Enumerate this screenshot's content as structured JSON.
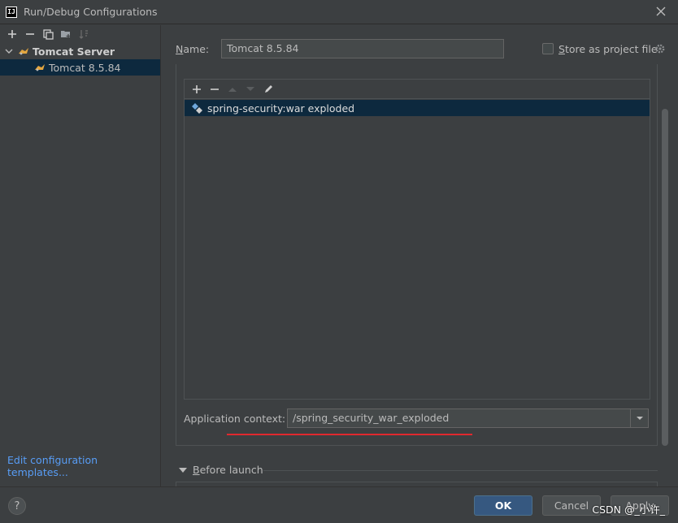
{
  "window": {
    "title": "Run/Debug Configurations",
    "logo_text": "IJ"
  },
  "left": {
    "tree": {
      "group_label": "Tomcat Server",
      "child_label": "Tomcat 8.5.84"
    },
    "edit_templates_link": "Edit configuration templates..."
  },
  "form": {
    "name_label_underlined": "N",
    "name_label_rest": "ame:",
    "name_value": "Tomcat 8.5.84",
    "store_label_underlined": "S",
    "store_label_rest": "tore as project file",
    "store_checked": false
  },
  "deployment": {
    "artifacts": [
      "spring-security:war exploded"
    ]
  },
  "app_context": {
    "label": "Application context:",
    "value": "/spring_security_war_exploded"
  },
  "before_launch": {
    "label_underlined": "B",
    "label_rest": "efore launch"
  },
  "buttons": {
    "ok": "OK",
    "cancel": "Cancel",
    "apply": "Apply"
  },
  "watermark": "CSDN @_小许_",
  "colors": {
    "background": "#3c3f41",
    "selection": "#0d293e",
    "ok_button": "#365880",
    "link": "#589df6",
    "annotation_underline": "#e0282e"
  }
}
